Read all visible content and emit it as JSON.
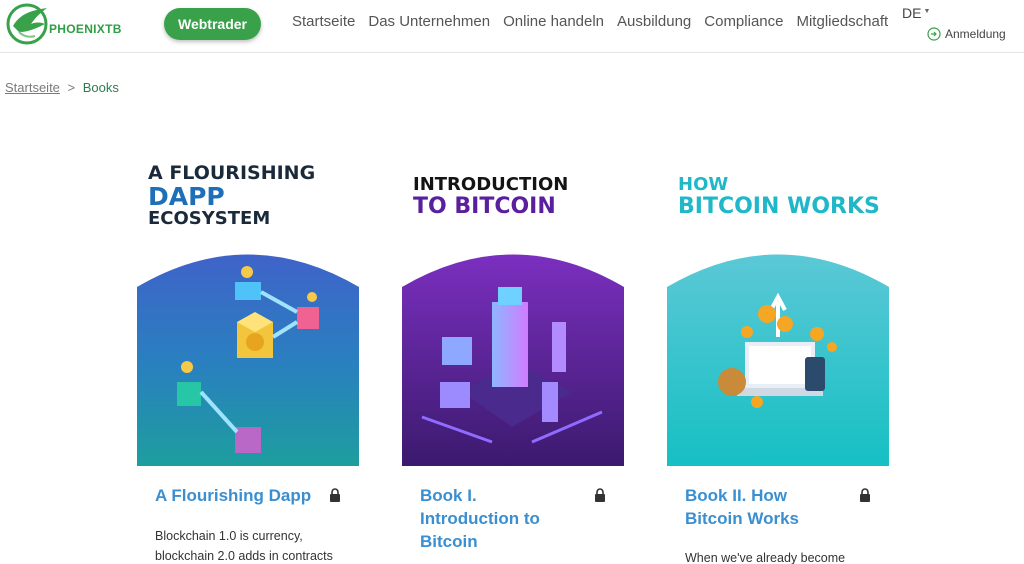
{
  "header": {
    "logo_text": "PHOENIXTB",
    "webtrader_label": "Webtrader",
    "nav": [
      "Startseite",
      "Das Unternehmen",
      "Online handeln",
      "Ausbildung",
      "Compliance",
      "Mitgliedschaft"
    ],
    "language": "DE",
    "login_label": "Anmeldung"
  },
  "breadcrumb": {
    "home": "Startseite",
    "separator": ">",
    "current": "Books"
  },
  "books": [
    {
      "cover_lines": [
        "A FLOURISHING",
        "DAPP",
        "ECOSYSTEM"
      ],
      "title": "A Flourishing Dapp",
      "description": "Blockchain 1.0 is currency, blockchain 2.0 adds in contracts"
    },
    {
      "cover_lines": [
        "INTRODUCTION",
        "TO BITCOIN"
      ],
      "title": "Book I. Introduction to Bitcoin",
      "description": ""
    },
    {
      "cover_lines": [
        "HOW",
        "BITCOIN WORKS"
      ],
      "title": "Book II. How Bitcoin Works",
      "description": "When we've already become"
    }
  ],
  "colors": {
    "brand_green": "#3aa14b",
    "link_blue": "#3a8fd1",
    "breadcrumb_current": "#2e7d4f"
  }
}
